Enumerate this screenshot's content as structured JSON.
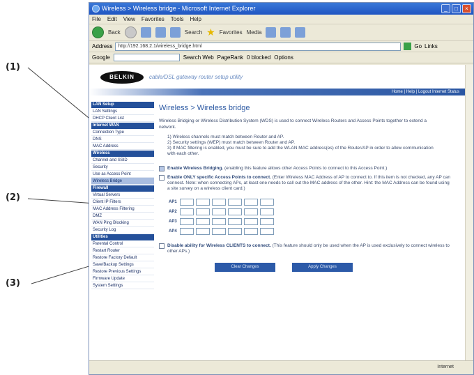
{
  "callouts": [
    "(1)",
    "(2)",
    "(3)"
  ],
  "browser": {
    "title": "Wireless > Wireless bridge - Microsoft Internet Explorer",
    "menu": [
      "File",
      "Edit",
      "View",
      "Favorites",
      "Tools",
      "Help"
    ],
    "toolbar": {
      "back": "Back",
      "search": "Search",
      "favorites": "Favorites",
      "media": "Media"
    },
    "address_label": "Address",
    "address": "http://192.168.2.1/wireless_bridge.html",
    "go": "Go",
    "links": "Links",
    "google": "Google",
    "google_search": "Search Web",
    "pagerank": "PageRank",
    "blocked": "0 blocked",
    "options": "Options",
    "status_zone": "Internet"
  },
  "page": {
    "logo": "BELKIN",
    "tagline": "cable/DSL gateway router setup utility",
    "header_links": "Home | Help | Logout   Internet Status",
    "sidebar": [
      {
        "type": "head",
        "label": "LAN Setup"
      },
      {
        "type": "item",
        "label": "LAN Settings"
      },
      {
        "type": "item",
        "label": "DHCP Client List"
      },
      {
        "type": "head",
        "label": "Internet WAN"
      },
      {
        "type": "item",
        "label": "Connection Type"
      },
      {
        "type": "item",
        "label": "DNS"
      },
      {
        "type": "item",
        "label": "MAC Address"
      },
      {
        "type": "head",
        "label": "Wireless"
      },
      {
        "type": "item",
        "label": "Channel and SSID"
      },
      {
        "type": "item",
        "label": "Security"
      },
      {
        "type": "item",
        "label": "Use as Access Point"
      },
      {
        "type": "item",
        "label": "Wireless Bridge",
        "active": true
      },
      {
        "type": "head",
        "label": "Firewall"
      },
      {
        "type": "item",
        "label": "Virtual Servers"
      },
      {
        "type": "item",
        "label": "Client IP Filters"
      },
      {
        "type": "item",
        "label": "MAC Address Filtering"
      },
      {
        "type": "item",
        "label": "DMZ"
      },
      {
        "type": "item",
        "label": "WAN Ping Blocking"
      },
      {
        "type": "item",
        "label": "Security Log"
      },
      {
        "type": "head",
        "label": "Utilities"
      },
      {
        "type": "item",
        "label": "Parental Control"
      },
      {
        "type": "item",
        "label": "Restart Router"
      },
      {
        "type": "item",
        "label": "Restore Factory Default"
      },
      {
        "type": "item",
        "label": "Save/Backup Settings"
      },
      {
        "type": "item",
        "label": "Restore Previous Settings"
      },
      {
        "type": "item",
        "label": "Firmware Update"
      },
      {
        "type": "item",
        "label": "System Settings"
      }
    ],
    "heading": "Wireless > Wireless bridge",
    "description": "Wireless Bridging or Wireless Distribution System (WDS) is used to connect Wireless Routers and Access Points together to extend a network.",
    "rules": [
      "1) Wireless channels must match between Router and AP.",
      "2) Security settings (WEP) must match between Router and AP.",
      "3) If MAC filtering is enabled, you must be sure to add the WLAN MAC address(es) of the Router/AP in order to allow communication with each other."
    ],
    "opt_enable_bold": "Enable Wireless Bridging.",
    "opt_enable_text": " (enabling this feature allows other Access Points to connect to this Access Point.)",
    "opt_specific_bold": "Enable ONLY specific Access Points to connect.",
    "opt_specific_text": " (Enter Wireless MAC Address of AP to connect to. If this item is not checked, any AP can connect. Note: when connecting APs, at least one needs to call out the MAC address of the other. Hint: the MAC Address can be found using a site survey on a wireless client card.)",
    "ap_labels": [
      "AP1",
      "AP2",
      "AP3",
      "AP4"
    ],
    "opt_disable_bold": "Disable ability for Wireless CLIENTS to connect.",
    "opt_disable_text": " (This feature should only be used when the AP is used exclusively to connect wireless to other APs.)",
    "clear_button": "Clear Changes",
    "apply_button": "Apply Changes"
  }
}
